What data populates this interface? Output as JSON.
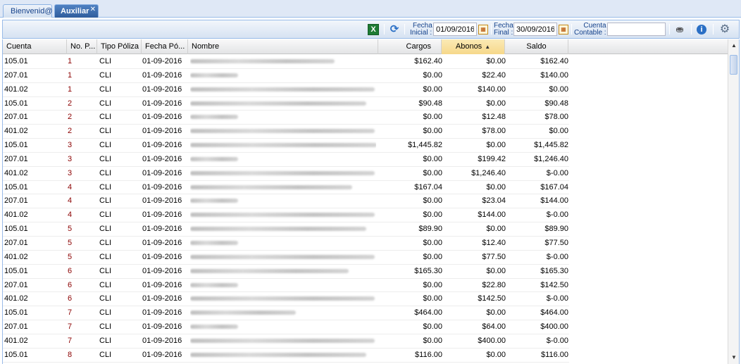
{
  "tabs": {
    "welcome": "Bienvenid@",
    "auxiliar": "Auxiliar",
    "close_glyph": "✕"
  },
  "toolbar": {
    "excel_icon": "excel-icon",
    "refresh_icon": "refresh-icon",
    "fecha_inicial_label_1": "Fecha",
    "fecha_inicial_label_2": "Inicial :",
    "fecha_inicial_value": "01/09/2016",
    "fecha_final_label_1": "Fecha",
    "fecha_final_label_2": "Final :",
    "fecha_final_value": "30/09/2016",
    "cuenta_label_1": "Cuenta",
    "cuenta_label_2": "Contable :",
    "cuenta_value": ""
  },
  "grid": {
    "columns": {
      "cuenta": "Cuenta",
      "nop": "No. P...",
      "tipo": "Tipo Póliza",
      "fecha": "Fecha Pó...",
      "nombre": "Nombre",
      "cargos": "Cargos",
      "abonos": "Abonos",
      "saldo": "Saldo"
    },
    "sorted_column": "abonos",
    "sort_direction": "asc",
    "rows": [
      {
        "cuenta": "105.01",
        "nop": "1",
        "tipo": "CLI",
        "fecha": "01-09-2016",
        "cargos": "$162.40",
        "abonos": "$0.00",
        "saldo": "$162.40"
      },
      {
        "cuenta": "207.01",
        "nop": "1",
        "tipo": "CLI",
        "fecha": "01-09-2016",
        "cargos": "$0.00",
        "abonos": "$22.40",
        "saldo": "$140.00"
      },
      {
        "cuenta": "401.02",
        "nop": "1",
        "tipo": "CLI",
        "fecha": "01-09-2016",
        "cargos": "$0.00",
        "abonos": "$140.00",
        "saldo": "$0.00"
      },
      {
        "cuenta": "105.01",
        "nop": "2",
        "tipo": "CLI",
        "fecha": "01-09-2016",
        "cargos": "$90.48",
        "abonos": "$0.00",
        "saldo": "$90.48"
      },
      {
        "cuenta": "207.01",
        "nop": "2",
        "tipo": "CLI",
        "fecha": "01-09-2016",
        "cargos": "$0.00",
        "abonos": "$12.48",
        "saldo": "$78.00"
      },
      {
        "cuenta": "401.02",
        "nop": "2",
        "tipo": "CLI",
        "fecha": "01-09-2016",
        "cargos": "$0.00",
        "abonos": "$78.00",
        "saldo": "$0.00"
      },
      {
        "cuenta": "105.01",
        "nop": "3",
        "tipo": "CLI",
        "fecha": "01-09-2016",
        "cargos": "$1,445.82",
        "abonos": "$0.00",
        "saldo": "$1,445.82"
      },
      {
        "cuenta": "207.01",
        "nop": "3",
        "tipo": "CLI",
        "fecha": "01-09-2016",
        "cargos": "$0.00",
        "abonos": "$199.42",
        "saldo": "$1,246.40"
      },
      {
        "cuenta": "401.02",
        "nop": "3",
        "tipo": "CLI",
        "fecha": "01-09-2016",
        "cargos": "$0.00",
        "abonos": "$1,246.40",
        "saldo": "$-0.00"
      },
      {
        "cuenta": "105.01",
        "nop": "4",
        "tipo": "CLI",
        "fecha": "01-09-2016",
        "cargos": "$167.04",
        "abonos": "$0.00",
        "saldo": "$167.04"
      },
      {
        "cuenta": "207.01",
        "nop": "4",
        "tipo": "CLI",
        "fecha": "01-09-2016",
        "cargos": "$0.00",
        "abonos": "$23.04",
        "saldo": "$144.00"
      },
      {
        "cuenta": "401.02",
        "nop": "4",
        "tipo": "CLI",
        "fecha": "01-09-2016",
        "cargos": "$0.00",
        "abonos": "$144.00",
        "saldo": "$-0.00"
      },
      {
        "cuenta": "105.01",
        "nop": "5",
        "tipo": "CLI",
        "fecha": "01-09-2016",
        "cargos": "$89.90",
        "abonos": "$0.00",
        "saldo": "$89.90"
      },
      {
        "cuenta": "207.01",
        "nop": "5",
        "tipo": "CLI",
        "fecha": "01-09-2016",
        "cargos": "$0.00",
        "abonos": "$12.40",
        "saldo": "$77.50"
      },
      {
        "cuenta": "401.02",
        "nop": "5",
        "tipo": "CLI",
        "fecha": "01-09-2016",
        "cargos": "$0.00",
        "abonos": "$77.50",
        "saldo": "$-0.00"
      },
      {
        "cuenta": "105.01",
        "nop": "6",
        "tipo": "CLI",
        "fecha": "01-09-2016",
        "cargos": "$165.30",
        "abonos": "$0.00",
        "saldo": "$165.30"
      },
      {
        "cuenta": "207.01",
        "nop": "6",
        "tipo": "CLI",
        "fecha": "01-09-2016",
        "cargos": "$0.00",
        "abonos": "$22.80",
        "saldo": "$142.50"
      },
      {
        "cuenta": "401.02",
        "nop": "6",
        "tipo": "CLI",
        "fecha": "01-09-2016",
        "cargos": "$0.00",
        "abonos": "$142.50",
        "saldo": "$-0.00"
      },
      {
        "cuenta": "105.01",
        "nop": "7",
        "tipo": "CLI",
        "fecha": "01-09-2016",
        "cargos": "$464.00",
        "abonos": "$0.00",
        "saldo": "$464.00"
      },
      {
        "cuenta": "207.01",
        "nop": "7",
        "tipo": "CLI",
        "fecha": "01-09-2016",
        "cargos": "$0.00",
        "abonos": "$64.00",
        "saldo": "$400.00"
      },
      {
        "cuenta": "401.02",
        "nop": "7",
        "tipo": "CLI",
        "fecha": "01-09-2016",
        "cargos": "$0.00",
        "abonos": "$400.00",
        "saldo": "$-0.00"
      },
      {
        "cuenta": "105.01",
        "nop": "8",
        "tipo": "CLI",
        "fecha": "01-09-2016",
        "cargos": "$116.00",
        "abonos": "$0.00",
        "saldo": "$116.00"
      }
    ]
  },
  "colors": {
    "accent": "#2f5d9d",
    "sorted_header": "#f6d88a",
    "nop_text": "#8b0000"
  }
}
